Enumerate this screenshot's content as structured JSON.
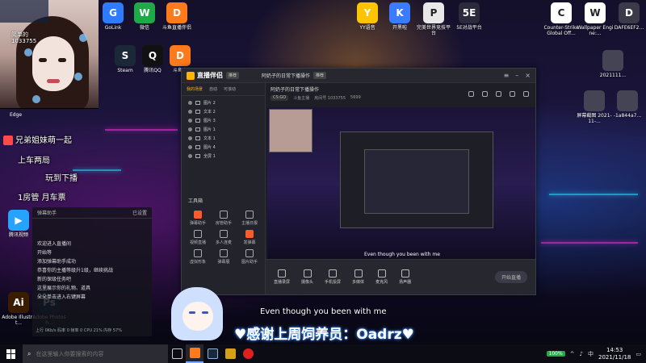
{
  "desktop": {
    "icons_top": [
      {
        "label": "GoLink",
        "glyph": "G",
        "color": "#2d7cff"
      },
      {
        "label": "微信",
        "glyph": "W",
        "color": "#1faa4a"
      },
      {
        "label": "斗鱼直播伴侣",
        "glyph": "D",
        "color": "#ff7a1a"
      },
      {
        "label": "YY语音",
        "glyph": "Y",
        "color": "#ffc400"
      },
      {
        "label": "开黑啦",
        "glyph": "K",
        "color": "#3b7bff"
      },
      {
        "label": "完美世界竞技平台",
        "glyph": "P",
        "color": "#e8e8e8"
      },
      {
        "label": "5E对战平台",
        "glyph": "5E",
        "color": "#2a2a3a"
      },
      {
        "label": "Counter-Strike Global Off...",
        "glyph": "C",
        "color": "#ffffff"
      },
      {
        "label": "Wallpaper Engine:...",
        "glyph": "W",
        "color": "#ffffff"
      },
      {
        "label": "DAFE6EF2...",
        "glyph": "D",
        "color": "#3a3a48"
      }
    ],
    "icons_second": [
      {
        "label": "Steam",
        "glyph": "S",
        "color": "#1b2838"
      },
      {
        "label": "腾讯QQ",
        "glyph": "Q",
        "color": "#111111"
      },
      {
        "label": "斗鱼直",
        "glyph": "D",
        "color": "#ff7a1a"
      }
    ],
    "icons_right": [
      {
        "label": "2021111...",
        "glyph": "",
        "color": "#444455"
      },
      {
        "label": "屏幕截图 2021-11-...",
        "glyph": "",
        "color": "#444455"
      },
      {
        "label": "-1a844a7...",
        "glyph": "",
        "color": "#444455"
      }
    ],
    "icons_left_bottom": [
      {
        "label": "腾讯视频",
        "glyph": "▶",
        "color": "#26a3ff"
      },
      {
        "label": "Adobe Illustrat...",
        "glyph": "Ai",
        "color": "#3a1d00"
      },
      {
        "label": "Adobe Photosh...",
        "glyph": "Ps",
        "color": "#001b33"
      }
    ],
    "edge_label": "Edge"
  },
  "webcam": {
    "overlay_name": "简单的",
    "overlay_id": "1033755"
  },
  "chat_overlay": [
    "兄弟姐妹萌一起",
    "上车两局",
    "玩到下播",
    "1房管  月车票"
  ],
  "danmaku_panel": {
    "title": "弹幕助手",
    "setting": "已设置",
    "messages": [
      "欢迎进入直播间",
      "开始等",
      "添加弹幕助手成功",
      "恭喜你的主播等级升1级，继续挑战",
      "新的保级任务吧",
      "这里展示你的礼物、道具",
      "朵朵单击进入右键屏幕"
    ],
    "stats": "上行 0Kb/s 码率 0 帧率 0 CPU 21% 内存 57%"
  },
  "stream_app": {
    "logo": "直播伴侣",
    "version": "推荐",
    "room_title": "阿奶子的日常下播操作",
    "room_tag": "推荐",
    "room_cat": "CS:GO",
    "room_sub": "斗鱼主播",
    "room_id": "房间号 1033755",
    "room_hot": "5699",
    "tabs": [
      "我的场景",
      "自动",
      "可滚动"
    ],
    "scenes": [
      "图片 2",
      "文本 2",
      "图片 3",
      "图片 1",
      "文本 1",
      "图片 4",
      "全屏 1"
    ],
    "tools_title": "工具箱",
    "tools": [
      {
        "label": "弹幕助手",
        "hot": true
      },
      {
        "label": "房管助手",
        "hot": false
      },
      {
        "label": "主播日报",
        "hot": false
      },
      {
        "label": "视频直播",
        "hot": false
      },
      {
        "label": "多人连麦",
        "hot": false
      },
      {
        "label": "发弹幕",
        "hot": true
      },
      {
        "label": "虚拟形象",
        "hot": false
      },
      {
        "label": "弹幕展",
        "hot": false
      },
      {
        "label": "图片助手",
        "hot": false
      }
    ],
    "bottom_buttons": [
      "直播录屏",
      "摄像头",
      "手机投屏",
      "多媒体",
      "麦克风",
      "扬声器"
    ],
    "start_label": "开始直播",
    "preview_caption": "Even though you been with me"
  },
  "subtitle": {
    "en": "Even though you been with me",
    "cn": "♥感谢上周饲养员：Oadrz♥"
  },
  "taskbar": {
    "search_placeholder": "在这里输入你要搜索的内容",
    "battery": "100%",
    "ime": "中",
    "time": "14:53",
    "date": "2021/11/18"
  }
}
